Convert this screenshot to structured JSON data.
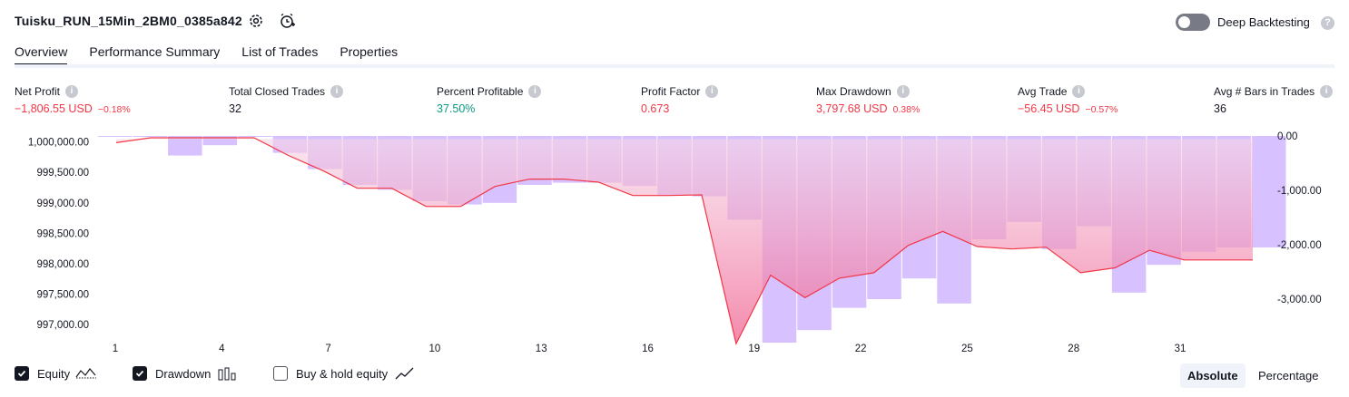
{
  "header": {
    "strategy_name": "Tuisku_RUN_15Min_2BM0_0385a842",
    "settings_icon": "gear-icon",
    "alert_icon": "alarm-add-icon",
    "deep_backtesting_label": "Deep Backtesting",
    "deep_backtesting_on": false,
    "help_mark": "?"
  },
  "tabs": [
    {
      "label": "Overview",
      "active": true
    },
    {
      "label": "Performance Summary",
      "active": false
    },
    {
      "label": "List of Trades",
      "active": false
    },
    {
      "label": "Properties",
      "active": false
    }
  ],
  "metrics": [
    {
      "label": "Net Profit",
      "value": "−1,806.55 USD",
      "pct": "−0.18%"
    },
    {
      "label": "Total Closed Trades",
      "value": "32"
    },
    {
      "label": "Percent Profitable",
      "value": "37.50%"
    },
    {
      "label": "Profit Factor",
      "value": "0.673"
    },
    {
      "label": "Max Drawdown",
      "value": "3,797.68 USD",
      "pct": "0.38%"
    },
    {
      "label": "Avg Trade",
      "value": "−56.45 USD",
      "pct": "−0.57%"
    },
    {
      "label": "Avg # Bars in Trades",
      "value": "36"
    }
  ],
  "info_mark": "i",
  "colors": {
    "negative": "#f23645",
    "positive": "#089981",
    "drawdown_bar": "#c8a6ff",
    "equity_line": "#f23645"
  },
  "chart_data": {
    "type": "line",
    "x_ticks": [
      "1",
      "4",
      "7",
      "10",
      "13",
      "16",
      "19",
      "22",
      "25",
      "28",
      "31"
    ],
    "left_axis_ticks": [
      "1,000,000.00",
      "999,500.00",
      "999,000.00",
      "998,500.00",
      "998,000.00",
      "997,500.00",
      "997,000.00"
    ],
    "right_axis_ticks": [
      "0.00",
      "-1,000.00",
      "-2,000.00",
      "-3,000.00"
    ],
    "left_ylim": [
      996700,
      1000100
    ],
    "right_ylim": [
      -3800,
      0
    ],
    "equity": [
      999990,
      1000070,
      1000070,
      1000070,
      1000070,
      999780,
      999530,
      999240,
      999240,
      998940,
      998940,
      999270,
      999390,
      999390,
      999340,
      999120,
      999120,
      999130,
      996680,
      997810,
      997440,
      997760,
      997850,
      998300,
      998530,
      998280,
      998240,
      998270,
      997850,
      997930,
      998220,
      998060,
      998060,
      998060
    ],
    "drawdown": [
      0,
      0,
      -360,
      -170,
      0,
      -310,
      -610,
      -900,
      -990,
      -1200,
      -1260,
      -1230,
      -900,
      -860,
      -860,
      -920,
      -1090,
      -1110,
      -1540,
      -3800,
      -3570,
      -3160,
      -3000,
      -2620,
      -3080,
      -1900,
      -1580,
      -2080,
      -1660,
      -2880,
      -2370,
      -2130,
      -2050,
      -2050
    ]
  },
  "legend": [
    {
      "label": "Equity",
      "checked": true,
      "icon": "equity-line-icon"
    },
    {
      "label": "Drawdown",
      "checked": true,
      "icon": "drawdown-bars-icon"
    },
    {
      "label": "Buy & hold equity",
      "checked": false,
      "icon": "buy-hold-line-icon"
    }
  ],
  "view_toggle": {
    "absolute": "Absolute",
    "percentage": "Percentage",
    "selected": "Absolute"
  }
}
